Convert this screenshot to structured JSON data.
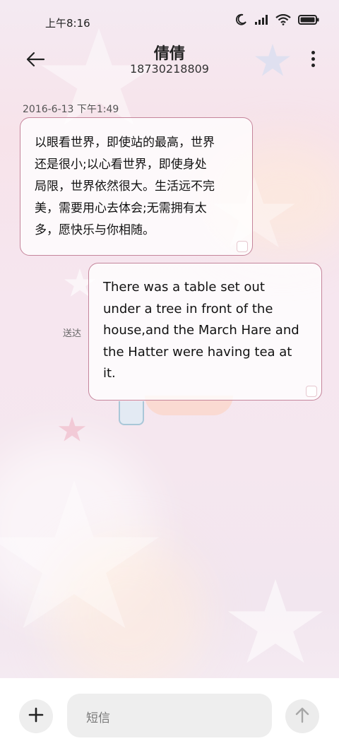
{
  "status_bar": {
    "time": "上午8:16",
    "icons": [
      "moon-icon",
      "cellular-signal-icon",
      "wifi-icon",
      "battery-icon"
    ]
  },
  "header": {
    "contact_name": "倩倩",
    "phone_number": "18730218809",
    "back_icon": "back-arrow-icon",
    "more_icon": "more-vertical-icon"
  },
  "conversation": {
    "timestamp": "2016-6-13 下午1:49",
    "messages": [
      {
        "direction": "incoming",
        "lines": [
          "以眼看世界，即使站的最高，世界",
          "还是很小;以心看世界，即使身处",
          "局限，世界依然很大。生活远不完",
          "美，需要用心去体会;无需拥有太",
          "多，愿快乐与你相随。"
        ]
      },
      {
        "direction": "outgoing",
        "status": "送达",
        "lines": [
          "There was a table set out",
          "under a tree in front of the",
          "house,and the March Hare and",
          "the Hatter were having tea at",
          "it."
        ]
      }
    ]
  },
  "compose": {
    "placeholder": "短信",
    "add_icon": "plus-icon",
    "send_icon": "send-arrow-up-icon"
  },
  "colors": {
    "bubble_border": "#c5859b",
    "bubble_fill": "#ffffff",
    "compose_bar": "#ffffff",
    "button_bg": "#eeeeee"
  }
}
